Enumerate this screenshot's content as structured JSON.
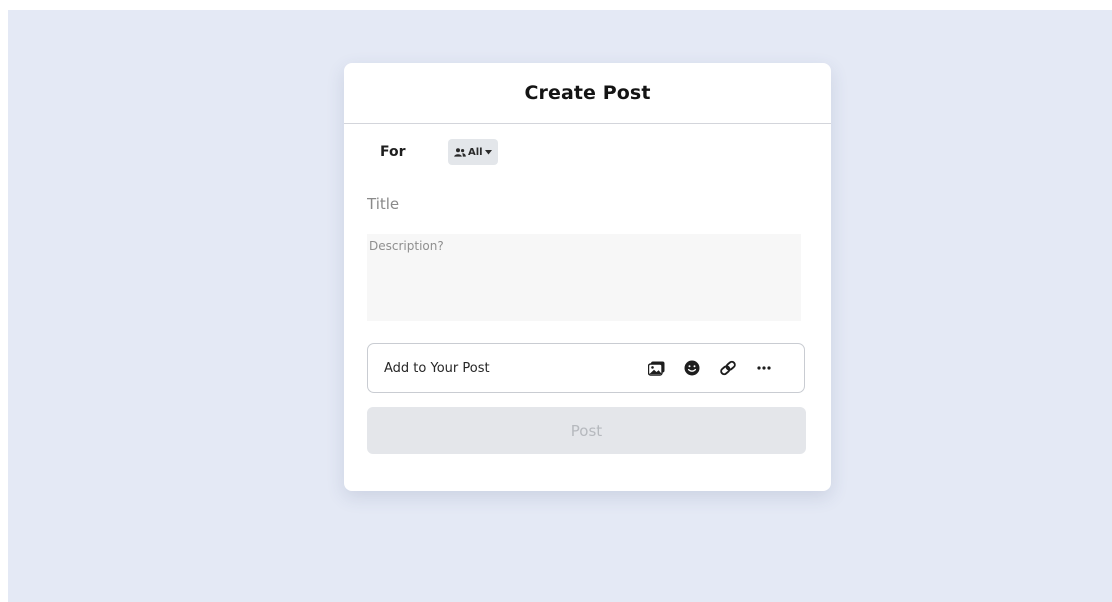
{
  "dialog": {
    "title": "Create Post",
    "for_label": "For",
    "audience": {
      "selected": "All",
      "icon": "users-icon"
    },
    "title_field": {
      "value": "",
      "placeholder": "Title"
    },
    "description_field": {
      "value": "",
      "placeholder": "Description?"
    },
    "add_to_post": {
      "label": "Add to Your Post",
      "tools": [
        "image-icon",
        "emoji-icon",
        "link-icon",
        "more-icon"
      ]
    },
    "post_button": {
      "label": "Post",
      "disabled": true
    }
  },
  "colors": {
    "page_background": "#e4e9f5",
    "card_background": "#ffffff",
    "disabled_button": "#e4e6ea",
    "disabled_text": "#b6b9be"
  }
}
